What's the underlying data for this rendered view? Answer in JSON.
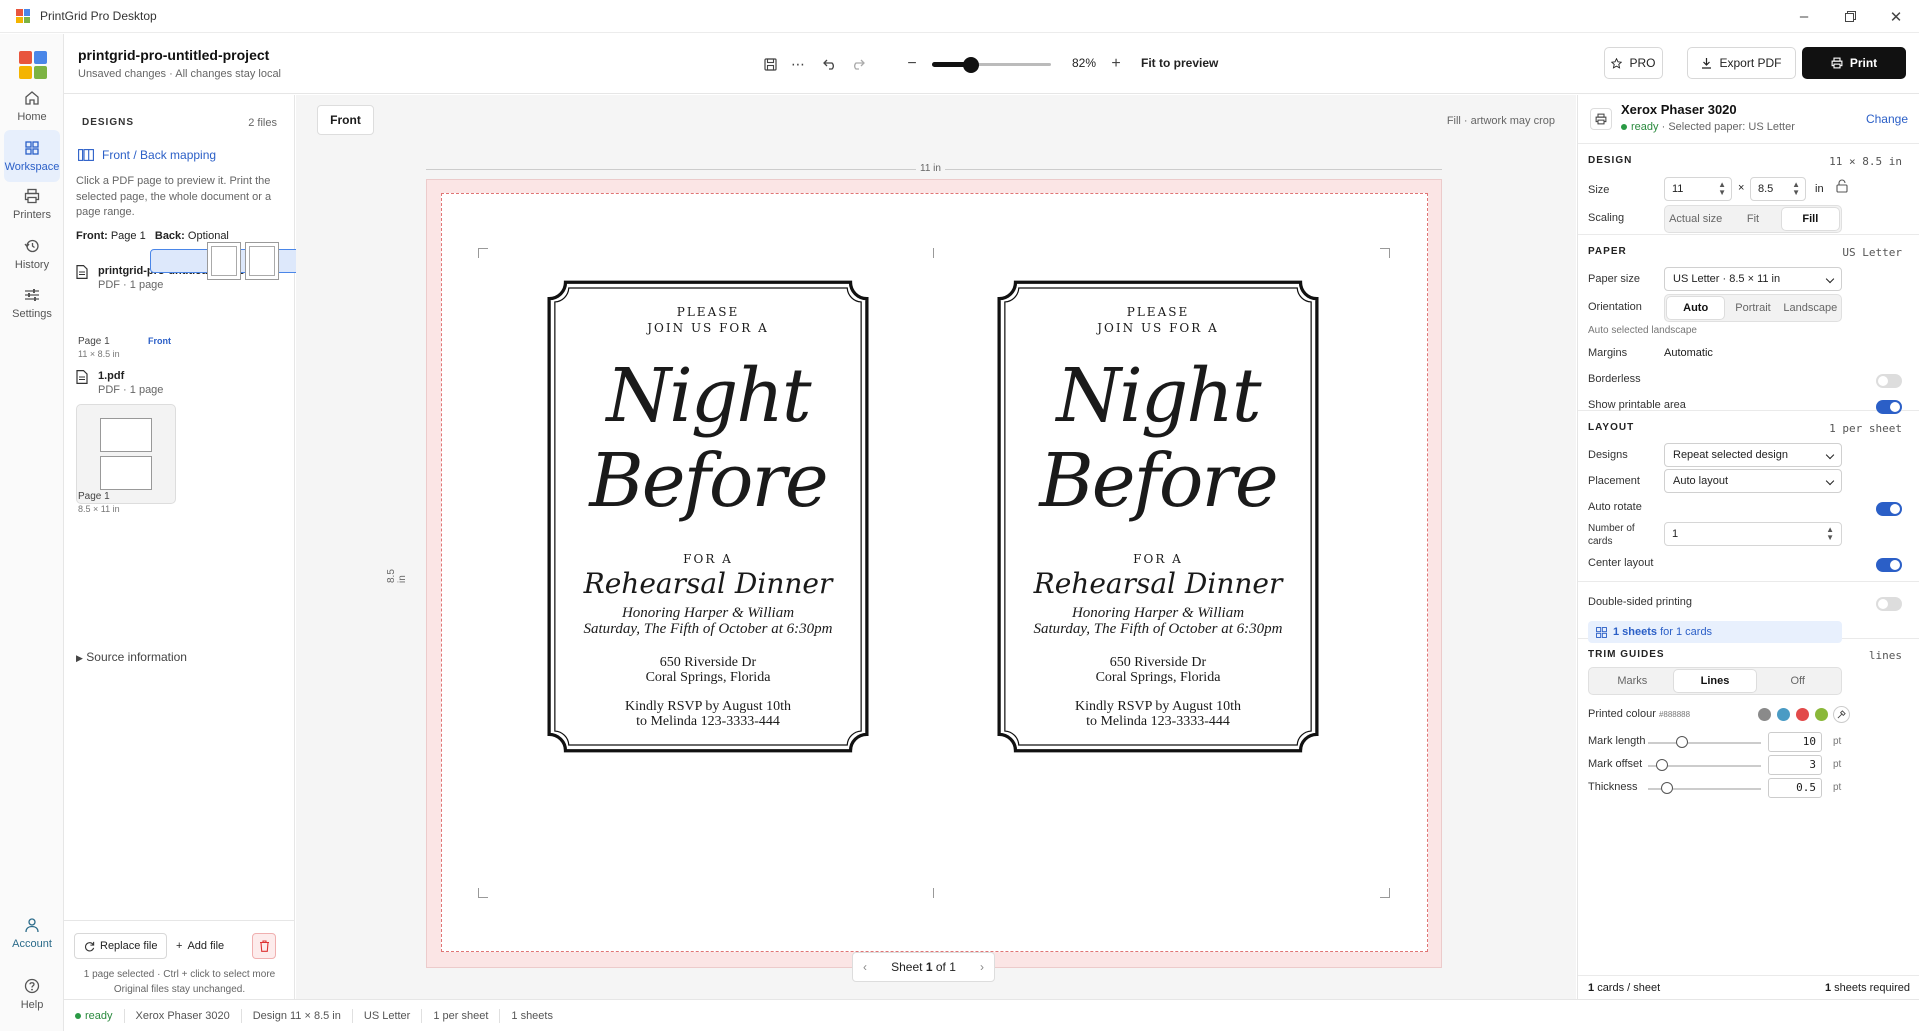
{
  "window": {
    "title": "PrintGrid Pro Desktop"
  },
  "nav": {
    "items": [
      {
        "label": "Home",
        "icon": "home-icon"
      },
      {
        "label": "Workspace",
        "icon": "grid-icon"
      },
      {
        "label": "Printers",
        "icon": "printer-icon"
      },
      {
        "label": "History",
        "icon": "history-icon"
      },
      {
        "label": "Settings",
        "icon": "sliders-icon"
      }
    ],
    "account": "Account",
    "help": "Help"
  },
  "header": {
    "project_name": "printgrid-pro-untitled-project",
    "project_status": "Unsaved changes · All changes stay local",
    "zoom": "82%",
    "zoom_level": 0.33,
    "fit_label": "Fit to preview",
    "pro_label": "PRO",
    "export_label": "Export PDF",
    "print_label": "Print"
  },
  "designs": {
    "title": "DESIGNS",
    "count": "2 files",
    "mapping_label": "Front / Back mapping",
    "hint": "Click a PDF page to preview it. Print the selected page, the whole document or a page range.",
    "front_key": "Front:",
    "front_val": "Page 1",
    "back_key": "Back:",
    "back_val": "Optional",
    "files": [
      {
        "name": "printgrid-pro-untitled-project.pdf",
        "meta": "PDF · 1 page",
        "page_label": "Page 1",
        "page_size": "11 × 8.5 in",
        "badge": "Front"
      },
      {
        "name": "1.pdf",
        "meta": "PDF · 1 page",
        "page_label": "Page 1",
        "page_size": "8.5 × 11 in"
      }
    ],
    "source_info": "Source information",
    "replace_label": "Replace file",
    "add_label": "Add file",
    "note1": "1 page selected · Ctrl + click to select more",
    "note2": "Original files stay unchanged."
  },
  "canvas": {
    "tab": "Front",
    "fill_note": "Fill · artwork may crop",
    "ruler_top": "11 in",
    "ruler_left": "8.5 in",
    "pager_prefix": "Sheet",
    "pager_current": "1",
    "pager_suffix": "of 1",
    "card": {
      "line1": "PLEASE",
      "line2": "JOIN US FOR A",
      "title1": "Night",
      "title2": "Before",
      "for_a": "FOR A",
      "event": "Rehearsal Dinner",
      "honoring": "Honoring Harper & William",
      "date": "Saturday, The Fifth of October at 6:30pm",
      "addr1": "650 Riverside Dr",
      "addr2": "Coral Springs, Florida",
      "rsvp1": "Kindly RSVP by August 10th",
      "rsvp2": "to Melinda 123-3333-444"
    }
  },
  "printer": {
    "name": "Xerox Phaser 3020",
    "status": "ready",
    "paper_note": "· Selected paper: US Letter",
    "change": "Change"
  },
  "design": {
    "title": "DESIGN",
    "summary": "11 × 8.5 in",
    "size_label": "Size",
    "width": "11",
    "height": "8.5",
    "times": "×",
    "unit": "in",
    "scaling_label": "Scaling",
    "scaling_options": [
      "Actual size",
      "Fit",
      "Fill"
    ]
  },
  "paper": {
    "title": "PAPER",
    "summary": "US Letter",
    "size_label": "Paper size",
    "size_value": "US Letter · 8.5 × 11 in",
    "orientation_label": "Orientation",
    "orientation_options": [
      "Auto",
      "Portrait",
      "Landscape"
    ],
    "auto_note": "Auto selected landscape",
    "margins_label": "Margins",
    "margins_value": "Automatic",
    "borderless_label": "Borderless",
    "printable_label": "Show printable area"
  },
  "layout": {
    "title": "LAYOUT",
    "summary": "1 per sheet",
    "designs_label": "Designs",
    "designs_value": "Repeat selected design",
    "placement_label": "Placement",
    "placement_value": "Auto layout",
    "autorotate_label": "Auto rotate",
    "cards_label_1": "Number of",
    "cards_label_2": "cards",
    "cards_value": "1",
    "center_label": "Center layout",
    "duplex_label": "Double-sided printing",
    "sheets_bold": "1 sheets",
    "sheets_rest": "for 1 cards"
  },
  "trim": {
    "title": "TRIM GUIDES",
    "summary": "lines",
    "options": [
      "Marks",
      "Lines",
      "Off"
    ],
    "colour_label": "Printed colour",
    "colour_hex": "#888888",
    "swatches": [
      "#8a8a8a",
      "#4a9bc4",
      "#e24a4a",
      "#8ab83a"
    ],
    "mark_length_label": "Mark length",
    "mark_length": "10",
    "mark_offset_label": "Mark offset",
    "mark_offset": "3",
    "thickness_label": "Thickness",
    "thickness": "0.5",
    "unit": "pt"
  },
  "footer": {
    "cards_per_sheet_num": "1",
    "cards_per_sheet_txt": "cards / sheet",
    "sheets_num": "1",
    "sheets_txt": "sheets required"
  },
  "status": {
    "state": "ready",
    "printer": "Xerox Phaser 3020",
    "design": "Design 11 × 8.5 in",
    "paper": "US Letter",
    "per_sheet": "1 per sheet",
    "sheets": "1 sheets"
  }
}
